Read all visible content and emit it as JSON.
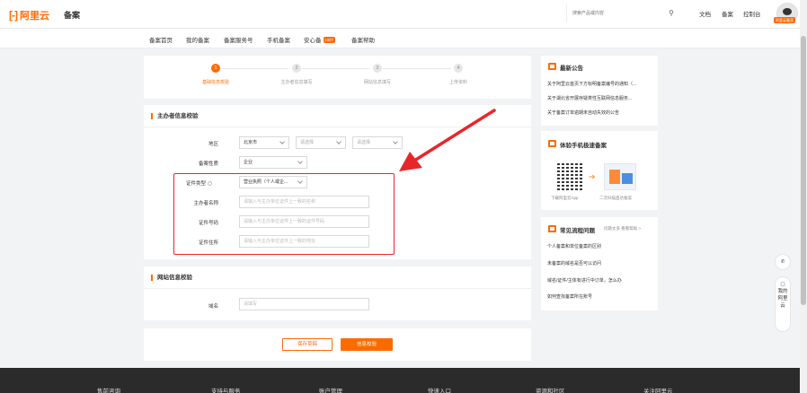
{
  "header": {
    "logo_text": "阿里云",
    "logo_bracket": "[-]",
    "section": "备案",
    "search_placeholder": "搜索产品或内容",
    "nav": [
      "文档",
      "备案",
      "控制台"
    ],
    "avatar_badge": "阿里云备案"
  },
  "subnav": {
    "items": [
      "备案首页",
      "我的备案",
      "备案服务号",
      "手机备案",
      "安心备",
      "备案帮助"
    ],
    "hot_badge": "HOT"
  },
  "steps": [
    {
      "num": "1",
      "label": "基础信息校验",
      "active": true
    },
    {
      "num": "2",
      "label": "主办者信息填写",
      "active": false
    },
    {
      "num": "3",
      "label": "网站信息填写",
      "active": false
    },
    {
      "num": "4",
      "label": "上传资料",
      "active": false
    }
  ],
  "sponsor_section": {
    "title": "主办者信息校验",
    "region_label": "地区",
    "region_values": [
      "北京市",
      "请选择",
      "请选择"
    ],
    "nature_label": "备案性质",
    "nature_value": "企业",
    "id_type_label": "证件类型",
    "id_type_value": "营业执照（个人或企...",
    "name_label": "主办者名称",
    "name_placeholder": "请输入与主办单位证件上一致的名称",
    "id_no_label": "证件号码",
    "id_no_placeholder": "请输入与主办单位证件上一致的证件号码",
    "address_label": "证件住所",
    "address_placeholder": "请输入与主办单位证件上一致的地址"
  },
  "website_section": {
    "title": "网站信息校验",
    "domain_label": "域名",
    "domain_placeholder": "请填写"
  },
  "buttons": {
    "save": "保存草稿",
    "submit": "信息校验"
  },
  "sidebar": {
    "announce_title": "最新公告",
    "announce_items": [
      "关于阿里云首页下方标明备案编号的通知（...",
      "关于湖北省开展存疑类性互联网信息服务...",
      "关于备案订单逾期未自动失效的公告"
    ],
    "mobile_title": "体验手机极速备案",
    "mobile_captions": [
      "下载阿里云App",
      "二次扫描直达备案"
    ],
    "faq_title": "常见流程问题",
    "faq_more": "问题太多 看看帮助 >",
    "faq_items": [
      "个人备案和单位备案的区别",
      "未备案的域名是否可以访问",
      "域名/证件/主体有进行中订单，怎么办",
      "如何查找备案所在账号"
    ]
  },
  "float": {
    "contact": "我的阿里云"
  },
  "footer": {
    "items": [
      "售前咨询",
      "支持与服务",
      "账户管理",
      "快速入口",
      "资源和社区",
      "关注阿里云"
    ]
  }
}
